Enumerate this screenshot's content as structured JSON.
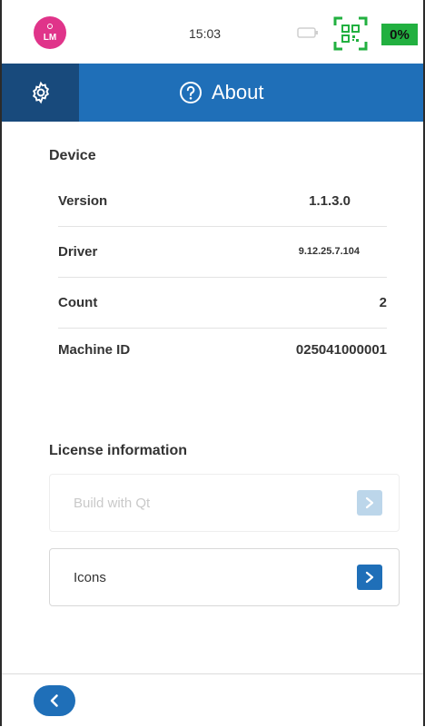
{
  "status_bar": {
    "avatar_initials": "LM",
    "time": "15:03",
    "battery_percent": "0%",
    "colors": {
      "avatar": "#e0348a",
      "battery_badge": "#22b040",
      "qr": "#22b040"
    }
  },
  "header": {
    "title": "About",
    "colors": {
      "bar": "#1f6fb8",
      "settings_tab": "#184a7c"
    }
  },
  "device": {
    "section_title": "Device",
    "rows": [
      {
        "label": "Version",
        "value": "1.1.3.0"
      },
      {
        "label": "Driver",
        "value": "9.12.25.7.104"
      },
      {
        "label": "Count",
        "value": "2"
      },
      {
        "label": "Machine ID",
        "value": "025041000001"
      }
    ]
  },
  "license": {
    "section_title": "License information",
    "items": [
      {
        "label": "Build with Qt",
        "enabled": false
      },
      {
        "label": "Icons",
        "enabled": true
      }
    ]
  },
  "icons": {
    "settings": "gear-icon",
    "help": "help-circle-icon",
    "back": "chevron-left-icon",
    "scan": "qr-scan-icon",
    "battery": "battery-icon"
  }
}
